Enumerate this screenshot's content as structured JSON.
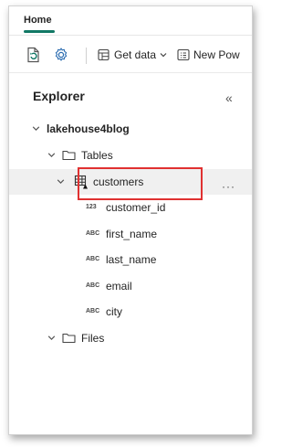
{
  "tabs": {
    "home": "Home"
  },
  "toolbar": {
    "get_data_label": "Get data",
    "new_power_label": "New Pow"
  },
  "explorer": {
    "title": "Explorer",
    "collapse_glyph": "«",
    "lakehouse_name": "lakehouse4blog",
    "tables_label": "Tables",
    "table_name": "customers",
    "more_glyph": "···",
    "columns": [
      {
        "type": "123",
        "name": "customer_id"
      },
      {
        "type": "ABC",
        "name": "first_name"
      },
      {
        "type": "ABC",
        "name": "last_name"
      },
      {
        "type": "ABC",
        "name": "email"
      },
      {
        "type": "ABC",
        "name": "city"
      }
    ],
    "files_label": "Files"
  },
  "colors": {
    "accent": "#117865",
    "highlight": "#e03131"
  }
}
